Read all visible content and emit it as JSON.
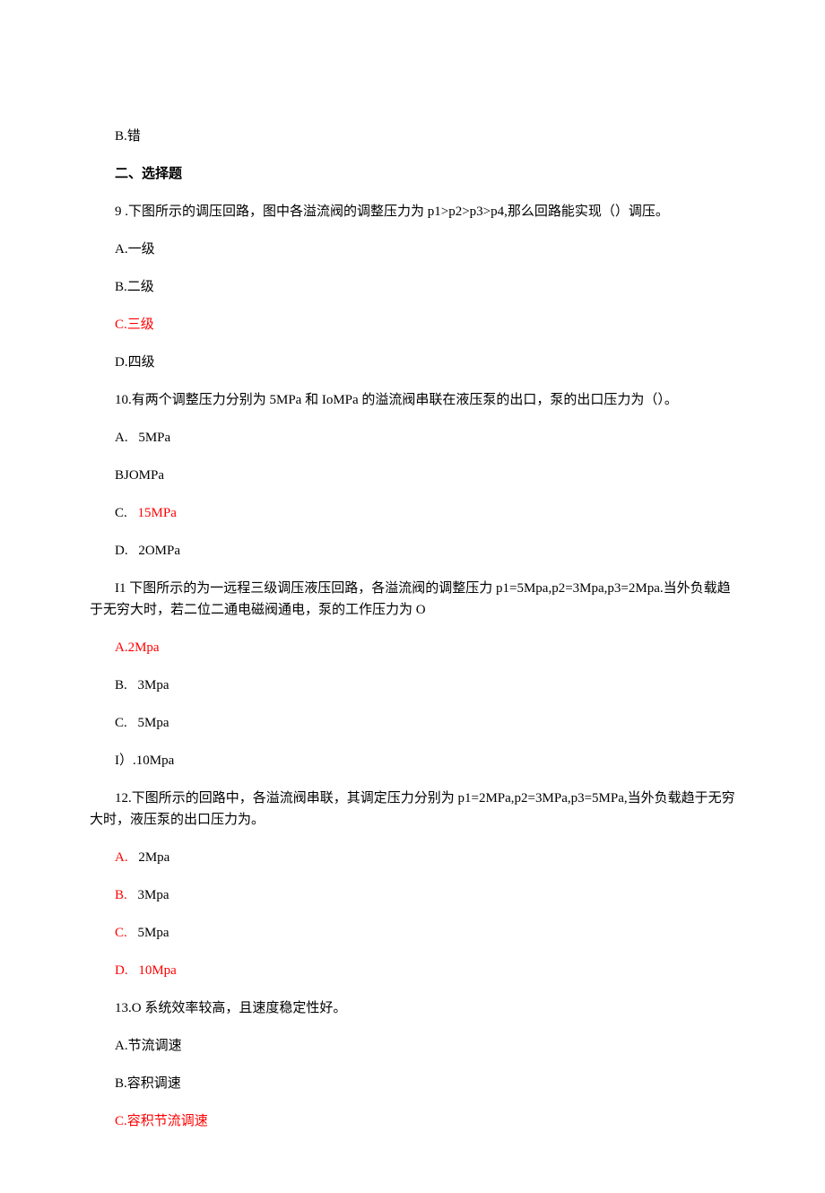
{
  "q8_optB": "B.错",
  "section2_title": "二、选择题",
  "q9_text": "9 .下图所示的调压回路，图中各溢流阀的调整压力为 p1>p2>p3>p4,那么回路能实现（）调压。",
  "q9_optA": "A.一级",
  "q9_optB": "B.二级",
  "q9_optC": "C.三级",
  "q9_optD": "D.四级",
  "q10_text": "10.有两个调整压力分别为 5MPa 和 IoMPa 的溢流阀串联在液压泵的出口，泵的出口压力为（）。",
  "q10_optA_prefix": "A.",
  "q10_optA_val": "5MPa",
  "q10_optB": "BJOMPa",
  "q10_optC_prefix": "C.",
  "q10_optC_val": "15MPa",
  "q10_optD_prefix": "D.",
  "q10_optD_val": "2OMPa",
  "q11_text": "I1 下图所示的为一远程三级调压液压回路，各溢流阀的调整压力 p1=5Mpa,p2=3Mpa,p3=2Mpa.当外负载趋于无穷大时，若二位二通电磁阀通电，泵的工作压力为 O",
  "q11_optA": "A.2Mpa",
  "q11_optB_prefix": "B.",
  "q11_optB_val": "3Mpa",
  "q11_optC_prefix": "C.",
  "q11_optC_val": "5Mpa",
  "q11_optD": "I）.10Mpa",
  "q12_text": "12.下图所示的回路中，各溢流阀串联，其调定压力分别为 p1=2MPa,p2=3MPa,p3=5MPa,当外负载趋于无穷大时，液压泵的出口压力为。",
  "q12_optA_prefix": "A.",
  "q12_optA_val": "2Mpa",
  "q12_optB_prefix": "B.",
  "q12_optB_val": "3Mpa",
  "q12_optC_prefix": "C.",
  "q12_optC_val": "5Mpa",
  "q12_optD_prefix": "D.",
  "q12_optD_val": "10Mpa",
  "q13_text": "13.O 系统效率较高，且速度稳定性好。",
  "q13_optA": "A.节流调速",
  "q13_optB": "B.容积调速",
  "q13_optC": "C.容积节流调速"
}
